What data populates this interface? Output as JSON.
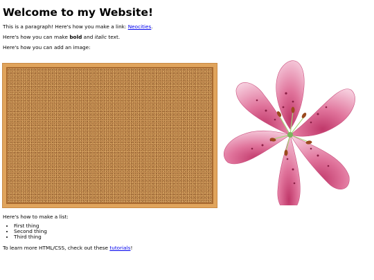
{
  "heading": "Welcome to my Website!",
  "intro": {
    "before_link": "This is a paragraph! Here's how you make a link: ",
    "link_text": "Neocities",
    "after_link": "."
  },
  "formatting": {
    "before": "Here's how you can make ",
    "bold": "bold",
    "middle": " and ",
    "italic": "italic",
    "after": " text."
  },
  "image_intro": "Here's how you can add an image:",
  "images": {
    "left": "corkboard",
    "right": "pink-lily-flower"
  },
  "list_intro": "Here's how to make a list:",
  "list_items": [
    "First thing",
    "Second thing",
    "Third thing"
  ],
  "outro": {
    "before_link": "To learn more HTML/CSS, check out these ",
    "link_text": "tutorials",
    "after_link": "!"
  }
}
